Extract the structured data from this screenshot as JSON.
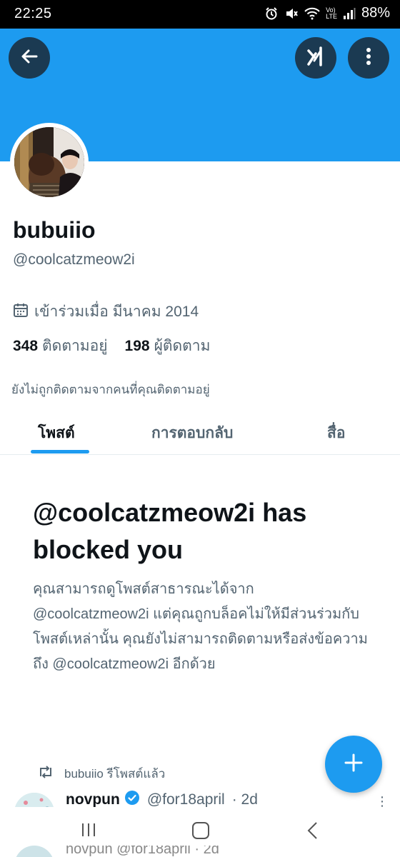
{
  "status_bar": {
    "time": "22:25",
    "battery": "88%",
    "icons": [
      "alarm-icon",
      "mute-icon",
      "wifi-icon",
      "volte-icon",
      "signal-icon"
    ],
    "volte_label_top": "Vo)",
    "volte_label_bottom": "LTE"
  },
  "header": {
    "banner_color": "#1d9bf0",
    "back_icon": "arrow-left-icon",
    "grok_icon": "grok-icon",
    "more_icon": "more-vertical-icon"
  },
  "profile": {
    "display_name": "bubuiio",
    "handle": "@coolcatzmeow2i",
    "joined": "เข้าร่วมเมื่อ มีนาคม 2014",
    "following_count": "348",
    "following_label": "ติดตามอยู่",
    "followers_count": "198",
    "followers_label": "ผู้ติดตาม",
    "not_followed_note": "ยังไม่ถูกติดตามจากคนที่คุณติดตามอยู่"
  },
  "tabs": [
    {
      "label": "โพสต์",
      "active": true
    },
    {
      "label": "การตอบกลับ",
      "active": false
    },
    {
      "label": "สื่อ",
      "active": false
    }
  ],
  "blocked": {
    "title": "@coolcatzmeow2i has blocked you",
    "description": "คุณสามารถดูโพสต์สาธารณะได้จาก @coolcatzmeow2i แต่คุณถูกบล็อคไม่ให้มีส่วนร่วมกับโพสต์เหล่านั้น คุณยังไม่สามารถติดตามหรือส่งข้อความถึง @coolcatzmeow2i อีกด้วย"
  },
  "feed": {
    "repost_label": "bubuiio รีโพสต์แล้ว",
    "tweet": {
      "name": "novpun",
      "handle": "@for18april",
      "time": "· 2d",
      "verified": true
    },
    "peek_text": "novpun @for18april · 2d"
  },
  "fab_icon": "plus-icon",
  "accent_color": "#1d9bf0"
}
